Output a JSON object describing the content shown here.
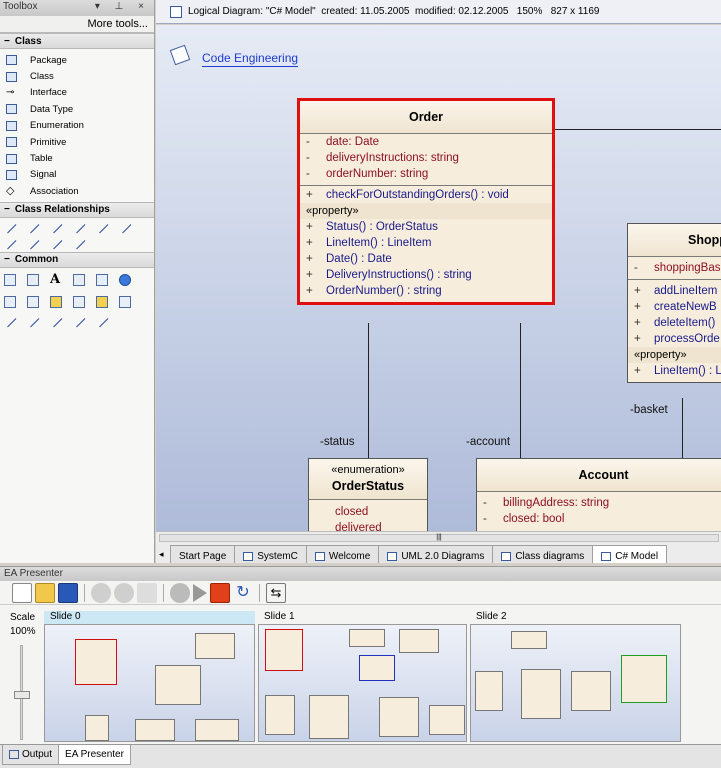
{
  "toolbox": {
    "title": "Toolbox",
    "more_tools": "More tools...",
    "sections": {
      "class": "Class",
      "relationships": "Class Relationships",
      "common": "Common"
    },
    "class_items": [
      "Package",
      "Class",
      "Interface",
      "Data Type",
      "Enumeration",
      "Primitive",
      "Table",
      "Signal",
      "Association"
    ]
  },
  "diagram": {
    "header": "Logical Diagram: \"C# Model\"  created: 11.05.2005  modified: 02.12.2005   150%   827 x 1169",
    "code_engineering": "Code Engineering",
    "order": {
      "name": "Order",
      "attrs": [
        {
          "vis": "-",
          "text": "date:  Date"
        },
        {
          "vis": "-",
          "text": "deliveryInstructions:  string"
        },
        {
          "vis": "-",
          "text": "orderNumber:  string"
        }
      ],
      "op": {
        "vis": "+",
        "text": "checkForOutstandingOrders() : void"
      },
      "stereo": "«property»",
      "props": [
        {
          "vis": "+",
          "text": "Status() : OrderStatus"
        },
        {
          "vis": "+",
          "text": "LineItem() : LineItem"
        },
        {
          "vis": "+",
          "text": "Date() : Date"
        },
        {
          "vis": "+",
          "text": "DeliveryInstructions() : string"
        },
        {
          "vis": "+",
          "text": "OrderNumber() : string"
        }
      ]
    },
    "shopping": {
      "name": "Shopp",
      "attr": {
        "vis": "-",
        "text": "shoppingBas"
      },
      "ops": [
        {
          "vis": "+",
          "text": "addLineItem"
        },
        {
          "vis": "+",
          "text": "createNewB"
        },
        {
          "vis": "+",
          "text": "deleteItem()"
        },
        {
          "vis": "+",
          "text": "processOrde"
        }
      ],
      "stereo": "«property»",
      "prop": {
        "vis": "+",
        "text": "LineItem() : L"
      }
    },
    "orderstatus": {
      "stereo": "«enumeration»",
      "name": "OrderStatus",
      "values": [
        "closed",
        "delivered"
      ]
    },
    "account": {
      "name": "Account",
      "attrs": [
        {
          "vis": "-",
          "text": "billingAddress:  string"
        },
        {
          "vis": "-",
          "text": "closed:  bool"
        }
      ]
    },
    "roles": {
      "status": "-status",
      "account": "-account",
      "basket": "-basket"
    },
    "tabs": [
      "Start Page",
      "SystemC",
      "Welcome",
      "UML 2.0 Diagrams",
      "Class diagrams",
      "C# Model"
    ]
  },
  "presenter": {
    "title": "EA Presenter",
    "scale_label": "Scale",
    "scale_value": "100%",
    "slides": [
      "Slide 0",
      "Slide 1",
      "Slide 2"
    ]
  },
  "bottom_tabs": [
    "Output",
    "EA Presenter"
  ]
}
